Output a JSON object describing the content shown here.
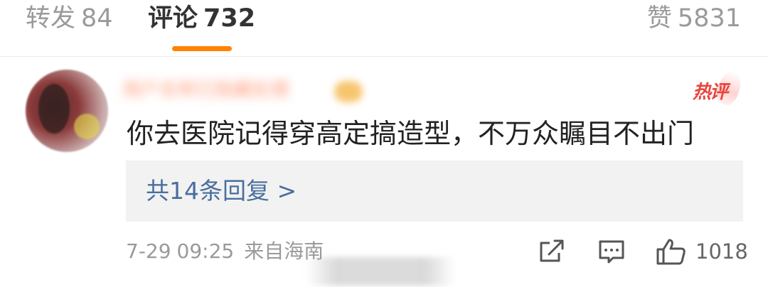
{
  "tabs": {
    "repost": {
      "label": "转发",
      "count": "84"
    },
    "comment": {
      "label": "评论",
      "count": "732",
      "active": true
    },
    "like": {
      "label": "赞",
      "count": "5831"
    }
  },
  "colors": {
    "accent": "#ff8200",
    "hot": "#e8463c",
    "link": "#4a6f9e",
    "muted": "#9a9a9a"
  },
  "comment": {
    "username": "用户名称已隐藏处理",
    "hot_tag": "热评",
    "text": "你去医院记得穿高定搞造型，不万众瞩目不出门",
    "replies_link": "共14条回复 >",
    "date": "7-29",
    "time": "09:25",
    "source": "来自海南",
    "like_count": "1018",
    "icons": [
      "share-icon",
      "comment-icon",
      "thumbs-up-icon"
    ]
  }
}
